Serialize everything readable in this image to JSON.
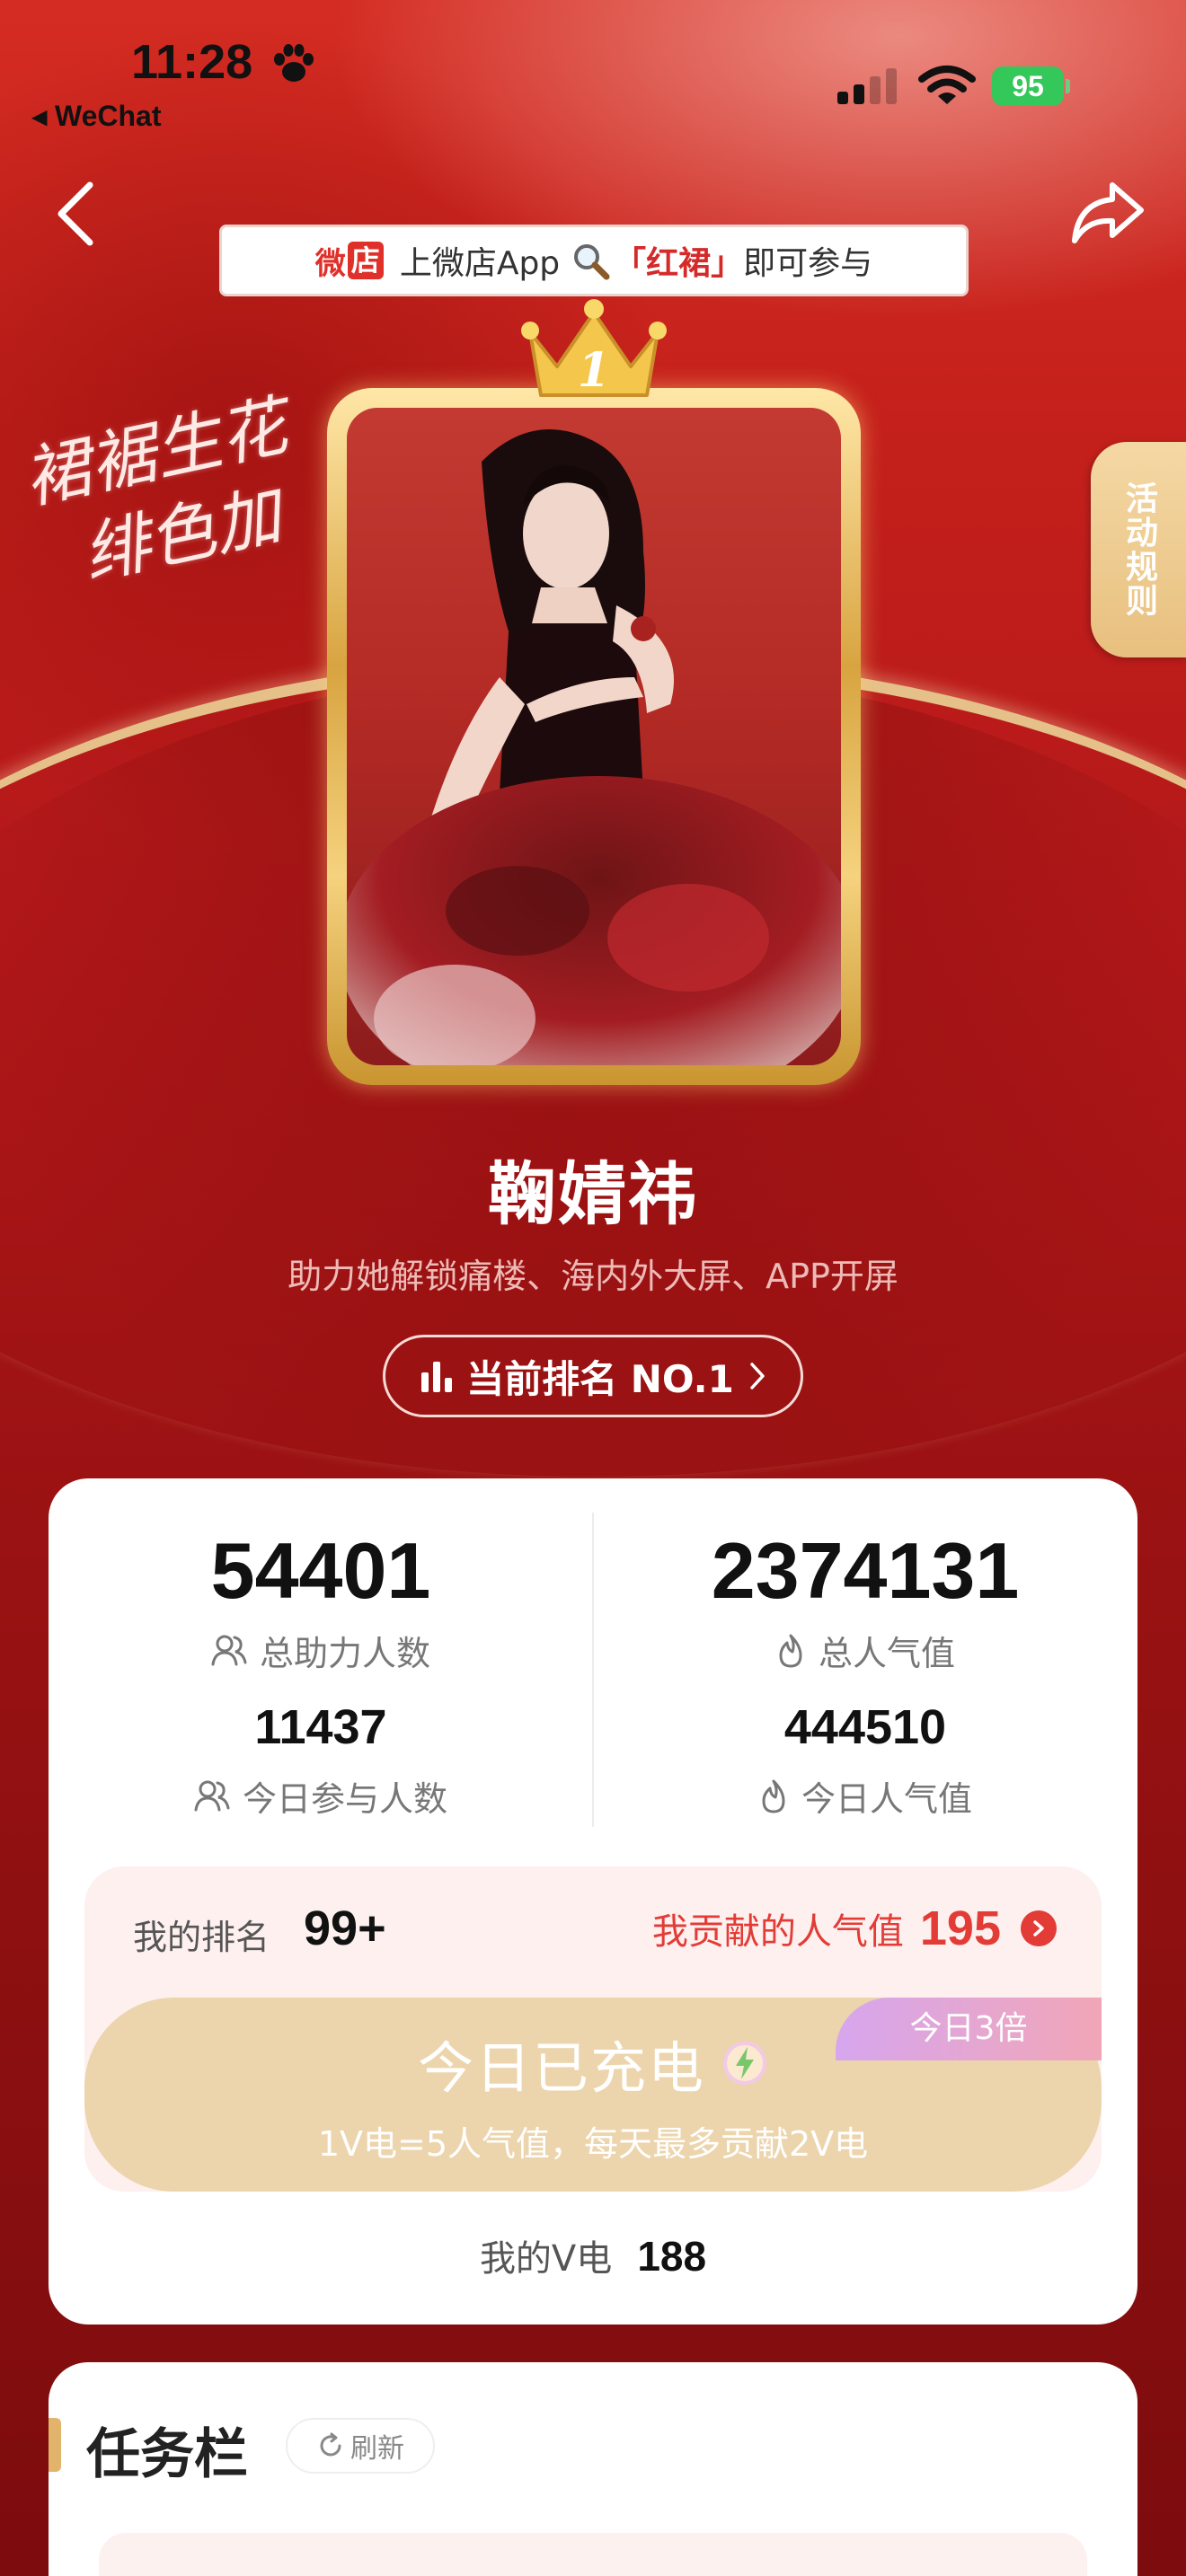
{
  "status_bar": {
    "time": "11:28",
    "back_app": "◂ WeChat",
    "battery": "95"
  },
  "banner": {
    "logo_prefix": "微",
    "logo_box": "店",
    "text_before": "上微店App",
    "keyword": "「红裙」",
    "text_after": "即可参与"
  },
  "side_tab": {
    "label": "活动规则"
  },
  "slogan": "裙裾生花\n  绯色加",
  "rank_badge": "1",
  "celebrity": {
    "name": "鞠婧祎",
    "tagline": "助力她解锁痛楼、海内外大屏、APP开屏"
  },
  "rank_pill": {
    "label": "当前排名 NO.1"
  },
  "stats": {
    "total_supporters": {
      "value": "54401",
      "label": "总助力人数"
    },
    "total_popularity": {
      "value": "2374131",
      "label": "总人气值"
    },
    "today_participants": {
      "value": "11437",
      "label": "今日参与人数"
    },
    "today_popularity": {
      "value": "444510",
      "label": "今日人气值"
    }
  },
  "my": {
    "rank_label": "我的排名",
    "rank_value": "99+",
    "contribution_label": "我贡献的人气值",
    "contribution_value": "195",
    "charge_title": "今日已充电",
    "charge_subtitle": "1V电=5人气值，每天最多贡献2V电",
    "multiplier_badge": "今日3倍",
    "v_label": "我的V电",
    "v_value": "188"
  },
  "tasks": {
    "title": "任务栏",
    "refresh_label": "刷新"
  },
  "colors": {
    "accent_red": "#e33b36",
    "gold": "#e8c07f",
    "charge_button": "#ecd5ad",
    "battery_green": "#34c759"
  },
  "icons": [
    "paw-icon",
    "signal-icon",
    "wifi-icon",
    "back-chevron-icon",
    "share-icon",
    "search-icon",
    "crown-icon",
    "bar-chart-icon",
    "chevron-right-icon",
    "users-icon",
    "flame-icon",
    "lightning-gem-icon",
    "refresh-icon"
  ]
}
